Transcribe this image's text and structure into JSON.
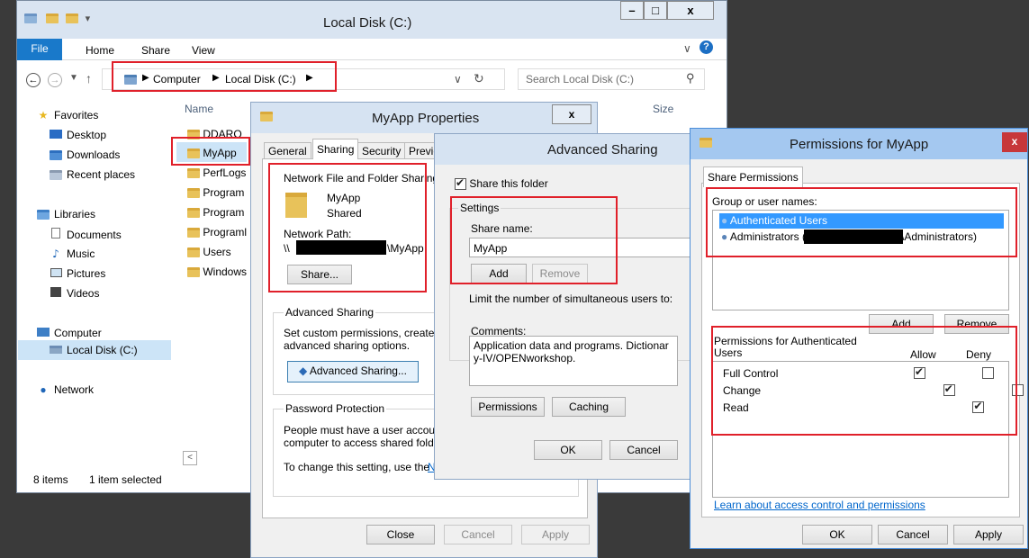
{
  "explorer": {
    "title": "Local Disk (C:)",
    "ribbon_tabs": [
      "File",
      "Home",
      "Share",
      "View"
    ],
    "address": {
      "part1": "Computer",
      "part2": "Local Disk (C:)"
    },
    "search_placeholder": "Search Local Disk (C:)",
    "nav_tree": {
      "favorites": "Favorites",
      "desktop": "Desktop",
      "downloads": "Downloads",
      "recent": "Recent places",
      "libraries": "Libraries",
      "documents": "Documents",
      "music": "Music",
      "pictures": "Pictures",
      "videos": "Videos",
      "computer": "Computer",
      "local_disk": "Local Disk (C:)",
      "network": "Network"
    },
    "columns": {
      "name": "Name",
      "size": "Size"
    },
    "files": [
      "DDARO",
      "MyApp",
      "PerfLogs",
      "Program",
      "Program",
      "Programl",
      "Users",
      "Windows"
    ],
    "status": {
      "items": "8 items",
      "selected": "1 item selected"
    }
  },
  "properties": {
    "title": "MyApp Properties",
    "tabs": [
      "General",
      "Sharing",
      "Security",
      "Previo"
    ],
    "nfs_group": "Network File and Folder Sharing",
    "folder_name": "MyApp",
    "folder_state": "Shared",
    "network_path_label": "Network Path:",
    "network_path_prefix": "\\\\",
    "network_path_suffix": "\\MyApp",
    "share_button": "Share...",
    "adv_group": "Advanced Sharing",
    "adv_text1": "Set custom permissions, create m",
    "adv_text2": "advanced sharing options.",
    "adv_button": "Advanced Sharing...",
    "pwd_group": "Password Protection",
    "pwd_text1": "People must have a user accoun",
    "pwd_text2": "computer to access shared folder",
    "pwd_text3": "To change this setting, use the",
    "pwd_link": "N",
    "close": "Close",
    "cancel": "Cancel",
    "apply": "Apply"
  },
  "advanced": {
    "title": "Advanced Sharing",
    "share_check": "Share this folder",
    "settings_label": "Settings",
    "share_name_label": "Share name:",
    "share_name_value": "MyApp",
    "add": "Add",
    "remove": "Remove",
    "limit_text": "Limit the number of simultaneous users to:",
    "comments_label": "Comments:",
    "comments_value": "Application data and programs. Dictionary-IV/OPENworkshop.",
    "permissions": "Permissions",
    "caching": "Caching",
    "ok": "OK",
    "cancel": "Cancel"
  },
  "permissions": {
    "title": "Permissions for MyApp",
    "tab": "Share Permissions",
    "group_label": "Group or user names:",
    "users": [
      "Authenticated Users",
      "Administrators ("
    ],
    "admin_suffix": "\\Administrators)",
    "add": "Add",
    "remove": "Remove",
    "perm_label": "Permissions for Authenticated Users",
    "allow": "Allow",
    "deny": "Deny",
    "rows": [
      {
        "name": "Full Control",
        "allow": true,
        "deny": false
      },
      {
        "name": "Change",
        "allow": true,
        "deny": false
      },
      {
        "name": "Read",
        "allow": true,
        "deny": false
      }
    ],
    "link": "Learn about access control and permissions",
    "ok": "OK",
    "cancel": "Cancel",
    "apply": "Apply"
  }
}
